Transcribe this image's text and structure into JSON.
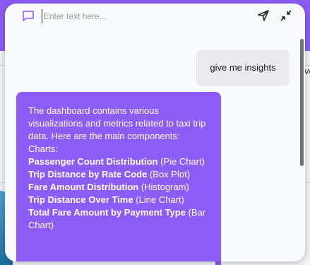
{
  "background": {
    "cut_text": "ve"
  },
  "chat": {
    "input_placeholder": "Enter text here...",
    "user_message": "give me insights",
    "bot_intro": "The dashboard contains various visualizations and metrics related to taxi trip data. Here are the main components:",
    "charts_label": "Charts:",
    "items": [
      {
        "name": "Passenger Count Distribution",
        "type": "(Pie Chart)"
      },
      {
        "name": "Trip Distance by Rate Code",
        "type": "(Box Plot)"
      },
      {
        "name": "Fare Amount Distribution",
        "type": "(Histogram)"
      },
      {
        "name": "Trip Distance Over Time",
        "type": "(Line Chart)"
      },
      {
        "name": "Total Fare Amount by Payment Type",
        "type": "(Bar Chart)"
      }
    ]
  },
  "colors": {
    "accent": "#8b5cf6",
    "panel_bg": "#f9fafb",
    "user_bubble": "#ececef"
  },
  "icons": {
    "chat": "chat-bubble-icon",
    "send": "send-icon",
    "minimize": "minimize-icon"
  }
}
